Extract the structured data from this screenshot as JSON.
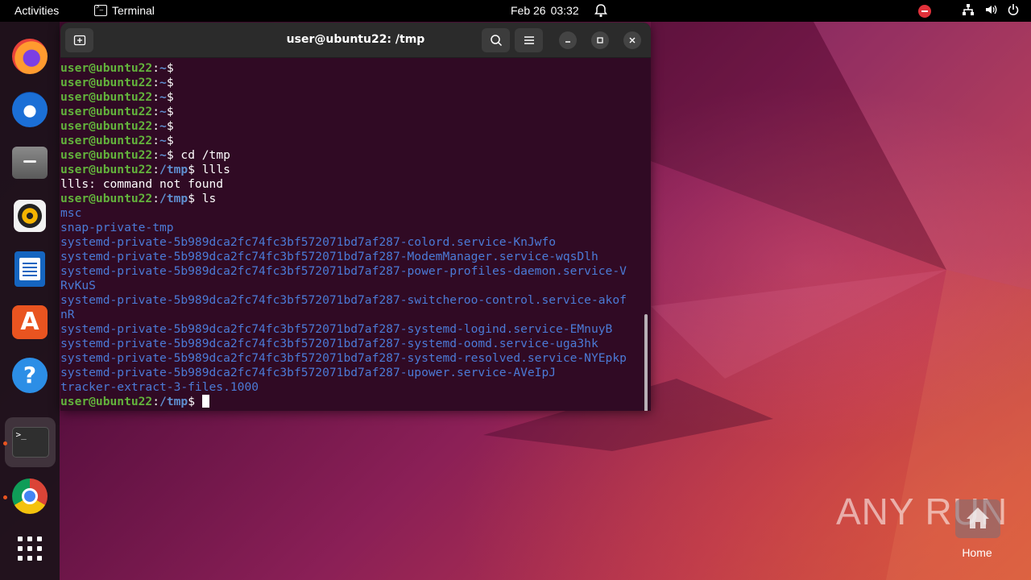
{
  "topbar": {
    "activities": "Activities",
    "app_name": "Terminal",
    "date": "Feb 26",
    "time": "03:32"
  },
  "dock": {
    "items": [
      "firefox-icon",
      "thunderbird-icon",
      "files-icon",
      "rhythmbox-icon",
      "libreoffice-writer-icon",
      "app-center-icon",
      "help-icon",
      "terminal-icon",
      "chrome-icon",
      "show-apps-icon"
    ]
  },
  "terminal": {
    "title": "user@ubuntu22: /tmp",
    "lines": [
      {
        "user": "user@ubuntu22",
        "path": "~",
        "cmd": ""
      },
      {
        "user": "user@ubuntu22",
        "path": "~",
        "cmd": ""
      },
      {
        "user": "user@ubuntu22",
        "path": "~",
        "cmd": ""
      },
      {
        "user": "user@ubuntu22",
        "path": "~",
        "cmd": ""
      },
      {
        "user": "user@ubuntu22",
        "path": "~",
        "cmd": ""
      },
      {
        "user": "user@ubuntu22",
        "path": "~",
        "cmd": ""
      },
      {
        "user": "user@ubuntu22",
        "path": "~",
        "cmd": " cd /tmp"
      },
      {
        "user": "user@ubuntu22",
        "path": "/tmp",
        "cmd": " llls"
      },
      {
        "text": "llls: command not found"
      },
      {
        "user": "user@ubuntu22",
        "path": "/tmp",
        "cmd": " ls"
      },
      {
        "dir": "msc"
      },
      {
        "dir": "snap-private-tmp"
      },
      {
        "dir": "systemd-private-5b989dca2fc74fc3bf572071bd7af287-colord.service-KnJwfo"
      },
      {
        "dir": "systemd-private-5b989dca2fc74fc3bf572071bd7af287-ModemManager.service-wqsDlh"
      },
      {
        "dir": "systemd-private-5b989dca2fc74fc3bf572071bd7af287-power-profiles-daemon.service-V"
      },
      {
        "dir": "RvKuS"
      },
      {
        "dir": "systemd-private-5b989dca2fc74fc3bf572071bd7af287-switcheroo-control.service-akof"
      },
      {
        "dir": "nR"
      },
      {
        "dir": "systemd-private-5b989dca2fc74fc3bf572071bd7af287-systemd-logind.service-EMnuyB"
      },
      {
        "dir": "systemd-private-5b989dca2fc74fc3bf572071bd7af287-systemd-oomd.service-uga3hk"
      },
      {
        "dir": "systemd-private-5b989dca2fc74fc3bf572071bd7af287-systemd-resolved.service-NYEpkp"
      },
      {
        "dir": "systemd-private-5b989dca2fc74fc3bf572071bd7af287-upower.service-AVeIpJ"
      },
      {
        "dir": "tracker-extract-3-files.1000"
      },
      {
        "user": "user@ubuntu22",
        "path": "/tmp",
        "cmd": " ",
        "cursor": true
      }
    ]
  },
  "desktop": {
    "home_label": "Home",
    "watermark": "ANY RUN"
  },
  "colors": {
    "terminal_bg": "#300a24",
    "prompt_user": "#63b33c",
    "prompt_path": "#5f8fd0",
    "accent": "#e95420"
  }
}
